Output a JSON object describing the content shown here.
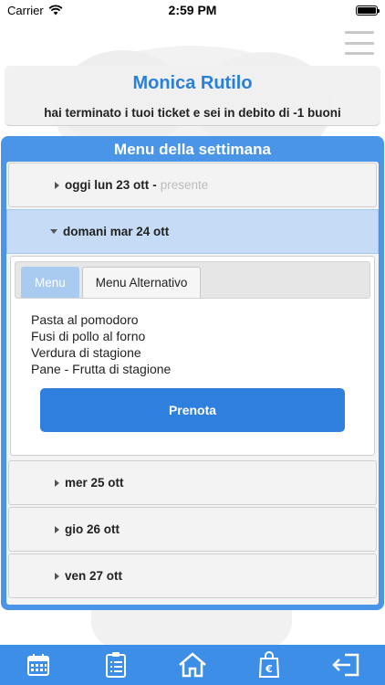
{
  "status": {
    "carrier": "Carrier",
    "time": "2:59 PM"
  },
  "user": {
    "name": "Monica Rutilo",
    "message": "hai terminato i tuoi ticket e sei in debito di -1 buoni"
  },
  "week": {
    "title": "Menu della settimana",
    "days": [
      {
        "label": "oggi lun 23 ott",
        "separator": "-",
        "status": "presente"
      },
      {
        "label": "domani mar 24 ott"
      },
      {
        "label": "mer 25 ott"
      },
      {
        "label": "gio 26 ott"
      },
      {
        "label": "ven 27 ott"
      }
    ],
    "tabs": [
      "Menu",
      "Menu Alternativo"
    ],
    "dishes": [
      "Pasta al pomodoro",
      "Fusi di pollo al forno",
      "Verdura di stagione",
      "Pane - Frutta di stagione"
    ],
    "book_label": "Prenota"
  },
  "nav": {
    "items": [
      "calendar-icon",
      "clipboard-icon",
      "home-icon",
      "euro-bag-icon",
      "logout-icon"
    ]
  },
  "colors": {
    "accent": "#2a7fd8",
    "panel": "#4a95e8",
    "bottom_bar": "#3d8ee6"
  }
}
